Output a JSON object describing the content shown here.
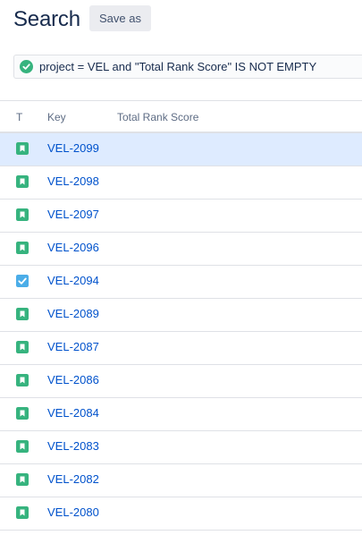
{
  "header": {
    "title": "Search",
    "save_as_label": "Save as"
  },
  "query": {
    "text": "project = VEL and \"Total Rank Score\" IS NOT EMPTY",
    "status_icon": "valid-check-icon",
    "status_color": "#36b37e"
  },
  "table": {
    "columns": {
      "type": "T",
      "key": "Key",
      "score": "Total Rank Score"
    },
    "rows": [
      {
        "key": "VEL-2099",
        "type": "story",
        "selected": true
      },
      {
        "key": "VEL-2098",
        "type": "story"
      },
      {
        "key": "VEL-2097",
        "type": "story"
      },
      {
        "key": "VEL-2096",
        "type": "story"
      },
      {
        "key": "VEL-2094",
        "type": "task"
      },
      {
        "key": "VEL-2089",
        "type": "story"
      },
      {
        "key": "VEL-2087",
        "type": "story"
      },
      {
        "key": "VEL-2086",
        "type": "story"
      },
      {
        "key": "VEL-2084",
        "type": "story"
      },
      {
        "key": "VEL-2083",
        "type": "story"
      },
      {
        "key": "VEL-2082",
        "type": "story"
      },
      {
        "key": "VEL-2080",
        "type": "story"
      }
    ]
  },
  "colors": {
    "story": "#36b37e",
    "task": "#4bade8",
    "link": "#0052cc",
    "selected_row": "#deebff"
  }
}
